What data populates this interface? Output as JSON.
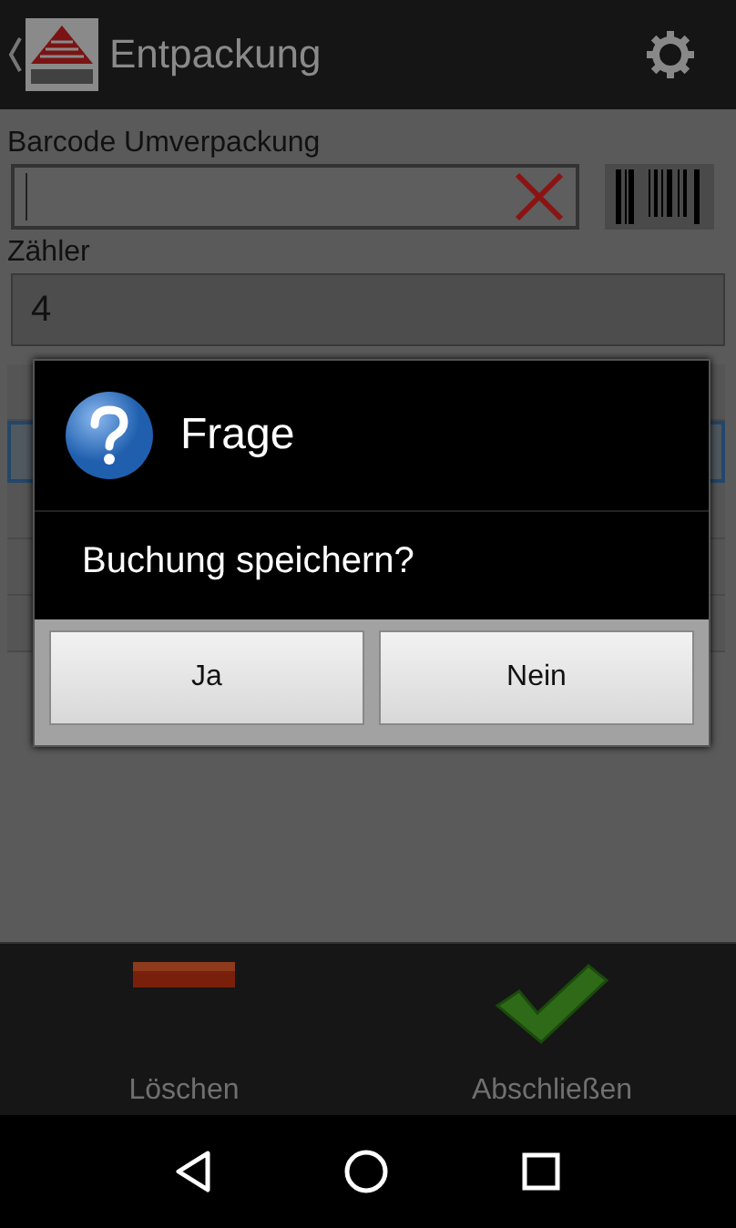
{
  "action_bar": {
    "title": "Entpackung"
  },
  "barcode_field": {
    "label": "Barcode Umverpackung"
  },
  "counter_field": {
    "label": "Zähler",
    "value": "4"
  },
  "list_rows": [
    {
      "selected": false
    },
    {
      "selected": true
    },
    {
      "selected": false
    },
    {
      "selected": false
    },
    {
      "selected": false
    }
  ],
  "dialog": {
    "title": "Frage",
    "message": "Buchung speichern?",
    "buttons": [
      "Ja",
      "Nein"
    ]
  },
  "bottom_actions": [
    {
      "label": "Löschen",
      "kind": "delete"
    },
    {
      "label": "Abschließen",
      "kind": "confirm"
    }
  ]
}
